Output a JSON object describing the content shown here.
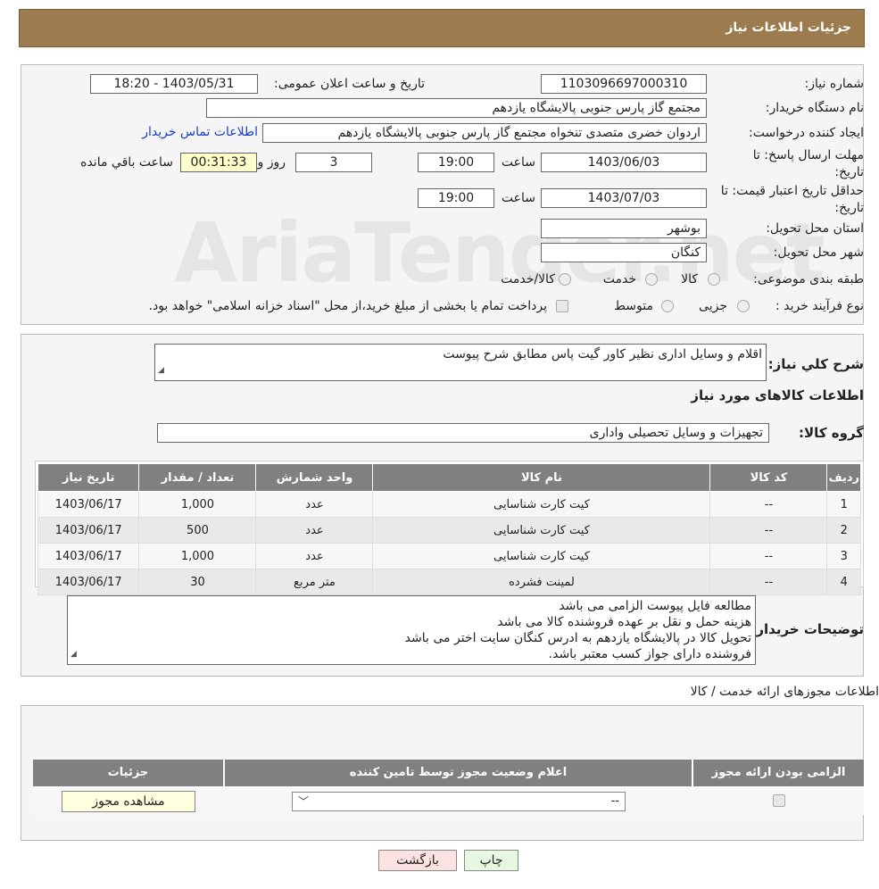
{
  "header": {
    "title": "جزئیات اطلاعات نیاز"
  },
  "watermark": "AriaTender.net",
  "form": {
    "need_number_label": "شماره نیاز:",
    "need_number": "1103096697000310",
    "announce_label": "تاریخ و ساعت اعلان عمومی:",
    "announce_value": "1403/05/31 - 18:20",
    "buyer_label": "نام دستگاه خریدار:",
    "buyer_value": "مجتمع گاز پارس جنوبی  پالایشگاه یازدهم",
    "creator_label": "ایجاد کننده درخواست:",
    "creator_value": "اردوان خضری متصدی تنخواه مجتمع گاز پارس جنوبی  پالایشگاه یازدهم",
    "contact_link": "اطلاعات تماس خریدار",
    "reply_deadline_label": "مهلت ارسال پاسخ: تا تاریخ:",
    "reply_date": "1403/06/03",
    "time_label": "ساعت",
    "reply_time": "19:00",
    "days": "3",
    "days_label": "روز و",
    "remaining_time": "00:31:33",
    "remaining_label": "ساعت باقي مانده",
    "price_validity_label": "حداقل تاریخ اعتبار قیمت: تا تاریخ:",
    "price_date": "1403/07/03",
    "price_time": "19:00",
    "province_label": "استان محل تحویل:",
    "province_value": "بوشهر",
    "city_label": "شهر محل تحویل:",
    "city_value": "کنگان",
    "category_label": "طبقه بندی موضوعی:",
    "category_options": [
      "کالا",
      "خدمت",
      "کالا/خدمت"
    ],
    "process_label": "نوع فرآیند خرید :",
    "process_options": [
      "جزیی",
      "متوسط"
    ],
    "payment_note": "پرداخت تمام یا بخشی از مبلغ خرید،از محل \"اسناد خزانه اسلامی\" خواهد بود."
  },
  "details": {
    "summary_label": "شرح کلي نیاز:",
    "summary_value": "اقلام و وسایل اداری نظیر کاور گیت پاس مطابق شرح پیوست",
    "items_title": "اطلاعات کالاهای مورد نیاز",
    "group_label": "گروه کالا:",
    "group_value": "تجهیزات و وسایل تحصیلی واداری",
    "table_headers": [
      "ردیف",
      "کد کالا",
      "نام کالا",
      "واحد شمارش",
      "تعداد / مقدار",
      "تاریخ نیاز"
    ],
    "rows": [
      [
        "1",
        "--",
        "کیت کارت شناسایی",
        "عدد",
        "1,000",
        "1403/06/17"
      ],
      [
        "2",
        "--",
        "کیت کارت شناسایی",
        "عدد",
        "500",
        "1403/06/17"
      ],
      [
        "3",
        "--",
        "کیت کارت شناسایی",
        "عدد",
        "1,000",
        "1403/06/17"
      ],
      [
        "4",
        "--",
        "لمینت فشرده",
        "متر مربع",
        "30",
        "1403/06/17"
      ]
    ],
    "buyer_notes_label": "توضیحات خریدار:",
    "buyer_notes": [
      "مطالعه فایل پیوست الزامی می باشد",
      "هزینه حمل و نقل بر عهده فروشنده کالا می باشد",
      "تحویل کالا در پالایشگاه یازدهم به ادرس کنگان سایت اختر می باشد",
      "فروشنده دارای جواز کسب معتبر باشد."
    ]
  },
  "permits": {
    "title": "اطلاعات مجوزهای ارائه خدمت / کالا",
    "headers": [
      "الزامی بودن ارائه مجوز",
      "اعلام وضعیت مجوز توسط تامین کننده",
      "جزئیات"
    ],
    "select_value": "--",
    "view_button": "مشاهده مجوز"
  },
  "buttons": {
    "print": "چاپ",
    "back": "بازگشت"
  }
}
